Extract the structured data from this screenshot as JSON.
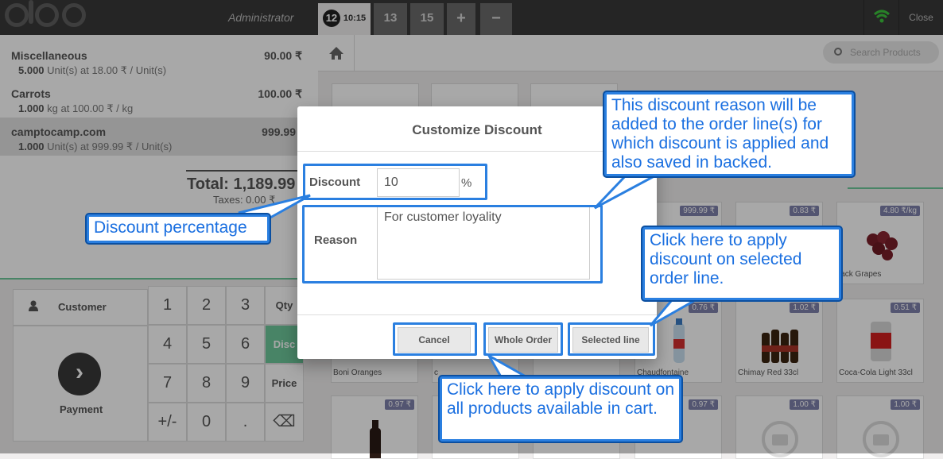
{
  "topbar": {
    "user": "Administrator",
    "orders": [
      {
        "number": "12",
        "time": "10:15"
      },
      {
        "number": "13"
      },
      {
        "number": "15"
      }
    ],
    "add_label": "+",
    "remove_label": "−",
    "close_label": "Close"
  },
  "orderlines": [
    {
      "name": "Miscellaneous",
      "price": "90.00 ₹",
      "qty": "5.000",
      "info": "Unit(s) at 18.00 ₹ / Unit(s)"
    },
    {
      "name": "Carrots",
      "price": "100.00 ₹",
      "qty": "1.000",
      "info": "kg at 100.00 ₹ / kg"
    },
    {
      "name": "camptocamp.com",
      "price": "999.99",
      "qty": "1.000",
      "info": "Unit(s) at 999.99 ₹ / Unit(s)"
    }
  ],
  "summary": {
    "total": "Total: 1,189.99",
    "taxes": "Taxes: 0.00 ₹"
  },
  "pad": {
    "customer_label": "Customer",
    "payment_label": "Payment",
    "payment_icon": "›",
    "keys": [
      "1",
      "2",
      "3",
      "Qty",
      "4",
      "5",
      "6",
      "Disc",
      "7",
      "8",
      "9",
      "Price",
      "+/-",
      "0",
      ".",
      "⌫"
    ]
  },
  "search": {
    "placeholder": "Search Products"
  },
  "products": [
    {
      "price": "999.99 ₹",
      "name": ""
    },
    {
      "price": "0.83 ₹",
      "name": ""
    },
    {
      "price": "4.80 ₹/kg",
      "name": "lack Grapes"
    },
    {
      "price": "",
      "name": "Boni Oranges"
    },
    {
      "price": "",
      "name": "c"
    },
    {
      "price": "",
      "name": ""
    },
    {
      "price": "0.76 ₹",
      "name": "Chaudfontaine"
    },
    {
      "price": "1.02 ₹",
      "name": "Chimay Red 33cl"
    },
    {
      "price": "0.51 ₹",
      "name": "Coca-Cola Light 33cl"
    },
    {
      "price": "0.97 ₹",
      "name": ""
    },
    {
      "price": "",
      "name": ""
    },
    {
      "price": "",
      "name": ""
    },
    {
      "price": "0.97 ₹",
      "name": ""
    },
    {
      "price": "1.00 ₹",
      "name": ""
    },
    {
      "price": "1.00 ₹",
      "name": ""
    }
  ],
  "dialog": {
    "title": "Customize Discount",
    "discount_label": "Discount",
    "discount_value": "10",
    "percent_sign": "%",
    "reason_label": "Reason",
    "reason_value": "For customer loyality",
    "cancel_label": "Cancel",
    "whole_order_label": "Whole Order",
    "selected_line_label": "Selected line"
  },
  "annotations": {
    "reason_note": "This discount reason will be added to the order line(s) for which discount is applied and also saved in backed.",
    "discount_note": "Discount percentage",
    "selected_line_note": "Click here to apply discount on selected order line.",
    "whole_order_note": "Click here to apply discount on all products available in cart.",
    "color": "#2a7fe0"
  },
  "colors": {
    "accent": "#6ec89b",
    "topbar": "#393939",
    "price_tag": "#7f82ac"
  }
}
